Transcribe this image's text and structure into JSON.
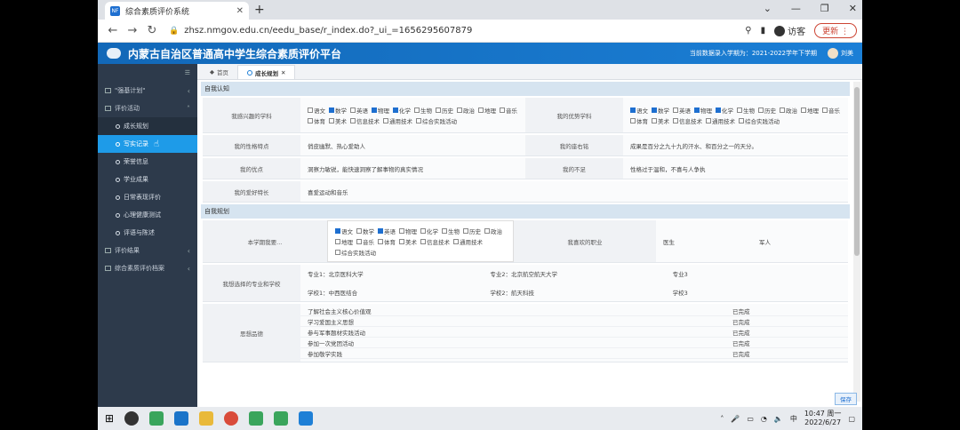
{
  "browser": {
    "tab_title": "综合素质评价系统",
    "url": "zhsz.nmgov.edu.cn/eedu_base/r_index.do?_ui_=1656295607879",
    "visitor": "访客",
    "update": "更新"
  },
  "app": {
    "title": "内蒙古自治区普通高中学生综合素质评价平台",
    "term": "当前数据录入学期为：2021-2022学年下学期",
    "user": "刘美"
  },
  "sidebar": {
    "items": [
      {
        "label": "\"强基计划\""
      },
      {
        "label": "评价活动"
      }
    ],
    "subitems": [
      {
        "label": "成长规划"
      },
      {
        "label": "写实记录"
      },
      {
        "label": "荣誉信息"
      },
      {
        "label": "学业成果"
      },
      {
        "label": "日常表现评价"
      },
      {
        "label": "心理健康测试"
      },
      {
        "label": "评语与陈述"
      }
    ],
    "bottom": [
      {
        "label": "评价结果"
      },
      {
        "label": "综合素质评价档案"
      }
    ]
  },
  "tabs": [
    {
      "label": "首页"
    },
    {
      "label": "成长规划"
    }
  ],
  "sections": {
    "self_know": "自我认知",
    "self_plan": "自我规划"
  },
  "rows": {
    "interest_label": "我感兴趣的学科",
    "strength_label": "我的优势学科",
    "subjects_row1": [
      "语文",
      "数学",
      "英语",
      "物理",
      "化学",
      "生物",
      "历史",
      "政治",
      "地理"
    ],
    "subjects_row2": [
      "音乐",
      "体育",
      "美术",
      "信息技术",
      "通用技术",
      "综合实践活动"
    ],
    "character_label": "我的性格特点",
    "character_value": "俏皮幽默、热心爱助人",
    "motto_label": "我的座右铭",
    "motto_value": "成果是百分之九十九的汗水、和百分之一的天分。",
    "merit_label": "我的优点",
    "merit_value": "洞察力敏锐，能快速洞察了解事物的真实情况",
    "weak_label": "我的不足",
    "weak_value": "性格过于温和，不喜与人争执",
    "hobby_label": "我的爱好特长",
    "hobby_value": "喜爱运动和音乐",
    "select_label": "本学期我要...",
    "career_label": "我喜欢的职业",
    "career1": "医生",
    "career2": "军人",
    "major_label": "我想选择的专业和学校",
    "major1": "专业1：北京医科大学",
    "major2": "专业2：北京航空航天大学",
    "major3": "专业3",
    "school1": "学校1：中西医结合",
    "school2": "学校2：航天科技",
    "school3": "学校3",
    "moral_label": "思想品德",
    "tasks": [
      {
        "name": "了解社会主义核心价值观",
        "status": "已完成"
      },
      {
        "name": "学习爱国主义思想",
        "status": "已完成"
      },
      {
        "name": "参与军事题材实践活动",
        "status": "已完成"
      },
      {
        "name": "参加一次党团活动",
        "status": "已完成"
      },
      {
        "name": "参加敬学实践",
        "status": "已完成"
      }
    ],
    "save": "保存"
  },
  "taskbar": {
    "time": "10:47 周一",
    "date": "2022/6/27"
  }
}
